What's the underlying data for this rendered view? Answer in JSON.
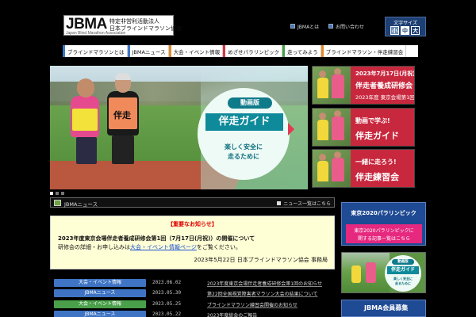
{
  "header": {
    "logo_mark": "JBMA",
    "logo_org_line1": "特定非営利活動法人",
    "logo_org_line2": "日本ブラインドマラソン協会",
    "logo_english": "Japan Blind Marathon Association",
    "link_1": "JBMAとは",
    "link_2": "お問い合わせ",
    "fontsize_label": "文字サイズ",
    "fontsize_small": "小",
    "fontsize_mid": "中",
    "fontsize_large": "大"
  },
  "nav": {
    "items": [
      {
        "label": "ブラインドマラソンとは",
        "color": "#3a78c8"
      },
      {
        "label": "JBMAニュース",
        "color": "#3a78c8"
      },
      {
        "label": "大会・イベント情報",
        "color": "#e08a2a"
      },
      {
        "label": "めざせパラリンピック",
        "color": "#d8353f"
      },
      {
        "label": "走ってみよう",
        "color": "#4aa04a"
      },
      {
        "label": "ブラインドマラソン・伴走練習会",
        "color": "#e08a2a"
      }
    ]
  },
  "hero": {
    "runner_bib": "伴走",
    "badge": "動画版",
    "title": "伴走ガイド",
    "subtitle_line1": "楽しく安全に",
    "subtitle_line2": "走るために"
  },
  "side_banners": [
    {
      "line1": "2023年7月17日(月祝)",
      "line2": "伴走者養成研修会",
      "line3": "2023年度 東京会場第1回"
    },
    {
      "line1": "動画で学ぶ!",
      "line2": "伴走ガイド"
    },
    {
      "line1": "一緒に走ろう!",
      "line2": "伴走練習会"
    }
  ],
  "news": {
    "title": "JBMAニュース",
    "more": "ニュース一覧はこちら"
  },
  "notice": {
    "heading": "【重要なお知らせ】",
    "line1": "2023年度東京会場伴走者養成研修会第1回（7月17日(月祝)）の開催について",
    "line2_prefix": "研修会の詳細・お申し込みは",
    "line2_link": "大会・イベント情報ページ",
    "line2_suffix": "をご覧ください。",
    "signature": "2023年5月22日 日本ブラインドマラソン協会 事務局"
  },
  "news_rows": [
    {
      "category": "大会・イベント情報",
      "color": "#3f74c4",
      "date": "2023.06.02",
      "text": "2023年度東京会場伴走者養成研修会第1回のお知らせ"
    },
    {
      "category": "JBMAニュース",
      "color": "#3f74c4",
      "date": "2023.05.30",
      "text": "第22回全国視覚障害者マラソン大会の結果について"
    },
    {
      "category": "大会・イベント情報",
      "color": "#4aa04a",
      "date": "2023.05.25",
      "text": "ブラインドマラソン練習会開催のお知らせ"
    },
    {
      "category": "JBMAニュース",
      "color": "#3f74c4",
      "date": "2023.05.22",
      "text": "2023年度総会のご報告"
    }
  ],
  "right": {
    "paralympic_title": "東京2020パラリンピック",
    "paralympic_btn_line1": "東京2020パラリンピックに",
    "paralympic_btn_line2": "関する記事一覧はこちら",
    "mini_badge": "動画版",
    "mini_title": "伴走ガイド",
    "mini_sub1": "楽しく安全に",
    "mini_sub2": "走るために",
    "jbma_box": "JBMA会員募集"
  }
}
